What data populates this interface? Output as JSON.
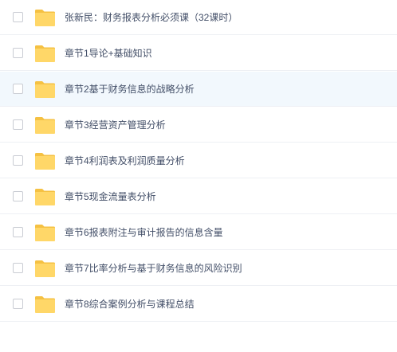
{
  "file_list": {
    "items": [
      {
        "label": "张新民：财务报表分析必须课（32课时）",
        "type": "folder-icon",
        "hovered": false
      },
      {
        "label": "章节1导论+基础知识",
        "type": "folder-icon",
        "hovered": false
      },
      {
        "label": "章节2基于财务信息的战略分析",
        "type": "folder-icon",
        "hovered": true
      },
      {
        "label": "章节3经营资产管理分析",
        "type": "folder-icon",
        "hovered": false
      },
      {
        "label": "章节4利润表及利润质量分析",
        "type": "folder-icon",
        "hovered": false
      },
      {
        "label": "章节5现金流量表分析",
        "type": "folder-icon",
        "hovered": false
      },
      {
        "label": "章节6报表附注与审计报告的信息含量",
        "type": "folder-icon",
        "hovered": false
      },
      {
        "label": "章节7比率分析与基于财务信息的风险识别",
        "type": "folder-icon",
        "hovered": false
      },
      {
        "label": "章节8综合案例分析与课程总结",
        "type": "folder-icon",
        "hovered": false
      }
    ]
  },
  "colors": {
    "folder_body": "#ffd768",
    "folder_tab": "#f5c143",
    "hover_bg": "#f2f8fd",
    "text": "#424e67",
    "divider": "#eef0f4"
  }
}
